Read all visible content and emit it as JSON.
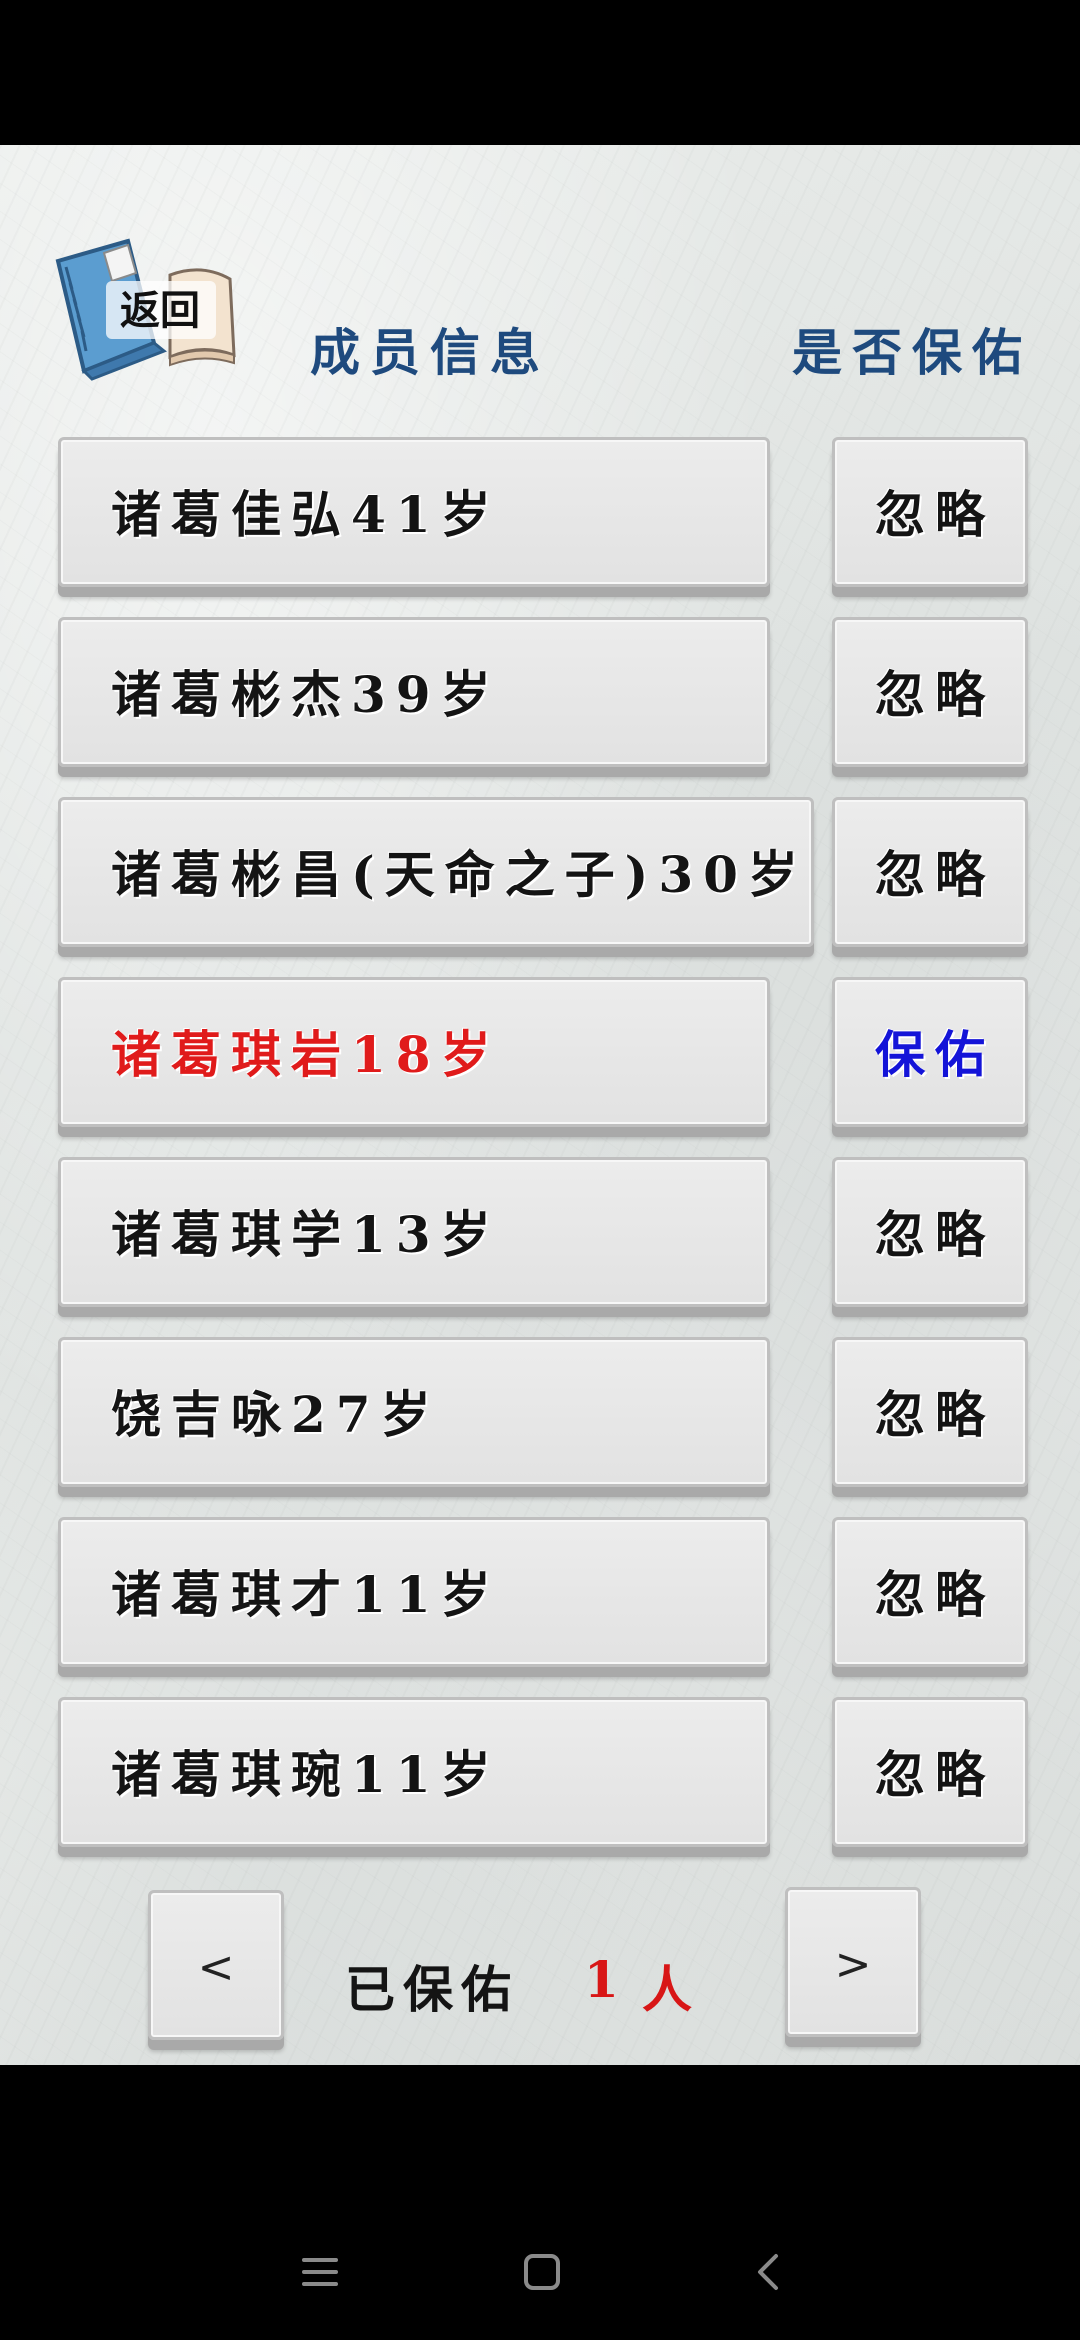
{
  "header": {
    "back_label": "返回",
    "title": "成员信息",
    "bless_title": "是否保佑"
  },
  "members": [
    {
      "name": "诸葛佳弘41岁",
      "action": "忽略"
    },
    {
      "name": "诸葛彬杰39岁",
      "action": "忽略"
    },
    {
      "name": "诸葛彬昌(天命之子)30岁",
      "action": "忽略"
    },
    {
      "name": "诸葛琪岩18岁",
      "action": "保佑"
    },
    {
      "name": "诸葛琪学13岁",
      "action": "忽略"
    },
    {
      "name": "饶吉咏27岁",
      "action": "忽略"
    },
    {
      "name": "诸葛琪才11岁",
      "action": "忽略"
    },
    {
      "name": "诸葛琪琬11岁",
      "action": "忽略"
    }
  ],
  "pagination": {
    "prev_label": "<",
    "next_label": ">",
    "blessed_label": "已保佑",
    "blessed_count": "1",
    "blessed_unit": "人"
  },
  "colors": {
    "header_text": "#1e4a7e",
    "highlight_name": "#e01b1b",
    "bless_action": "#1414d8",
    "count": "#d81616"
  },
  "icons": [
    "book-icon",
    "menu-icon",
    "home-icon",
    "back-icon"
  ]
}
